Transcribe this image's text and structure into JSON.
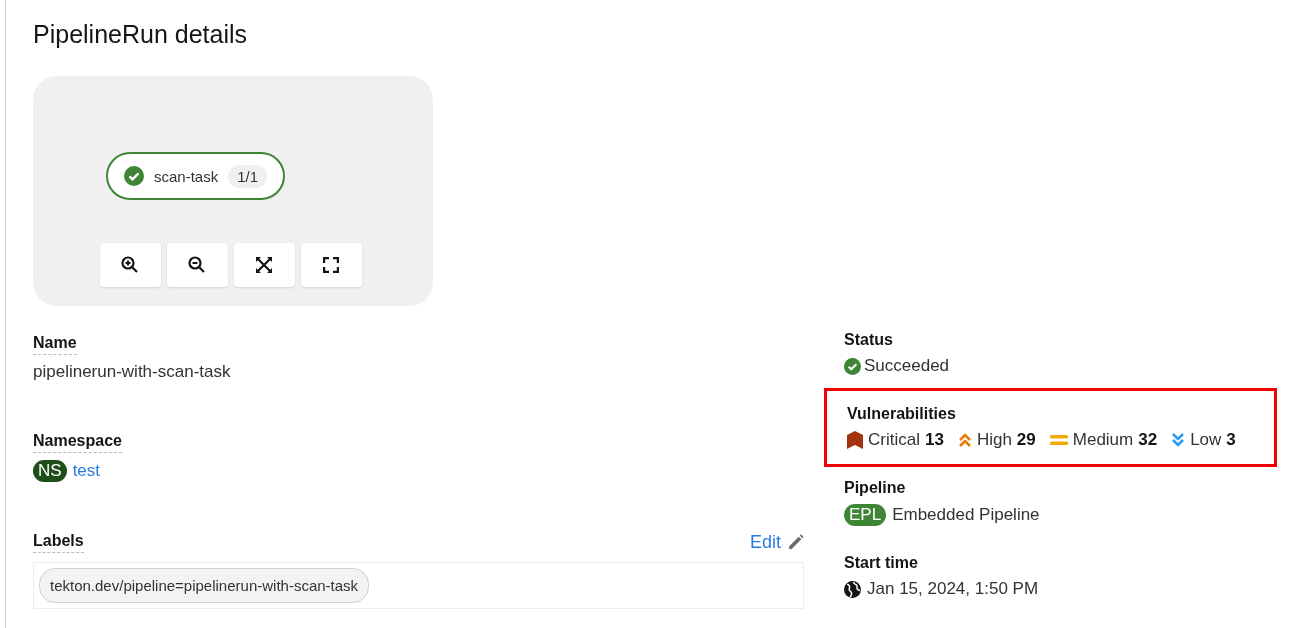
{
  "title": "PipelineRun details",
  "topology": {
    "node": {
      "label": "scan-task",
      "count": "1/1",
      "succeeded": true
    },
    "controls": [
      {
        "kind": "zoom-in"
      },
      {
        "kind": "zoom-out"
      },
      {
        "kind": "fit"
      },
      {
        "kind": "expand"
      }
    ]
  },
  "name": {
    "label": "Name",
    "value": "pipelinerun-with-scan-task"
  },
  "namespace": {
    "label": "Namespace",
    "badge": "NS",
    "value": "test"
  },
  "labels": {
    "label": "Labels",
    "edit": "Edit",
    "items": [
      "tekton.dev/pipeline=pipelinerun-with-scan-task"
    ]
  },
  "status": {
    "label": "Status",
    "value": "Succeeded",
    "kind": "succeeded"
  },
  "vulnerabilities": {
    "label": "Vulnerabilities",
    "highlighted": true,
    "items": [
      {
        "kind": "critical",
        "name": "Critical",
        "count": "13",
        "color": "#a4330f"
      },
      {
        "kind": "high",
        "name": "High",
        "count": "29",
        "color": "#ec7a08"
      },
      {
        "kind": "medium",
        "name": "Medium",
        "count": "32",
        "color": "#f0ab00"
      },
      {
        "kind": "low",
        "name": "Low",
        "count": "3",
        "color": "#2b9af3"
      }
    ]
  },
  "pipeline": {
    "label": "Pipeline",
    "badge": "EPL",
    "value": "Embedded Pipeline"
  },
  "start_time": {
    "label": "Start time",
    "value": "Jan 15, 2024, 1:50 PM"
  }
}
